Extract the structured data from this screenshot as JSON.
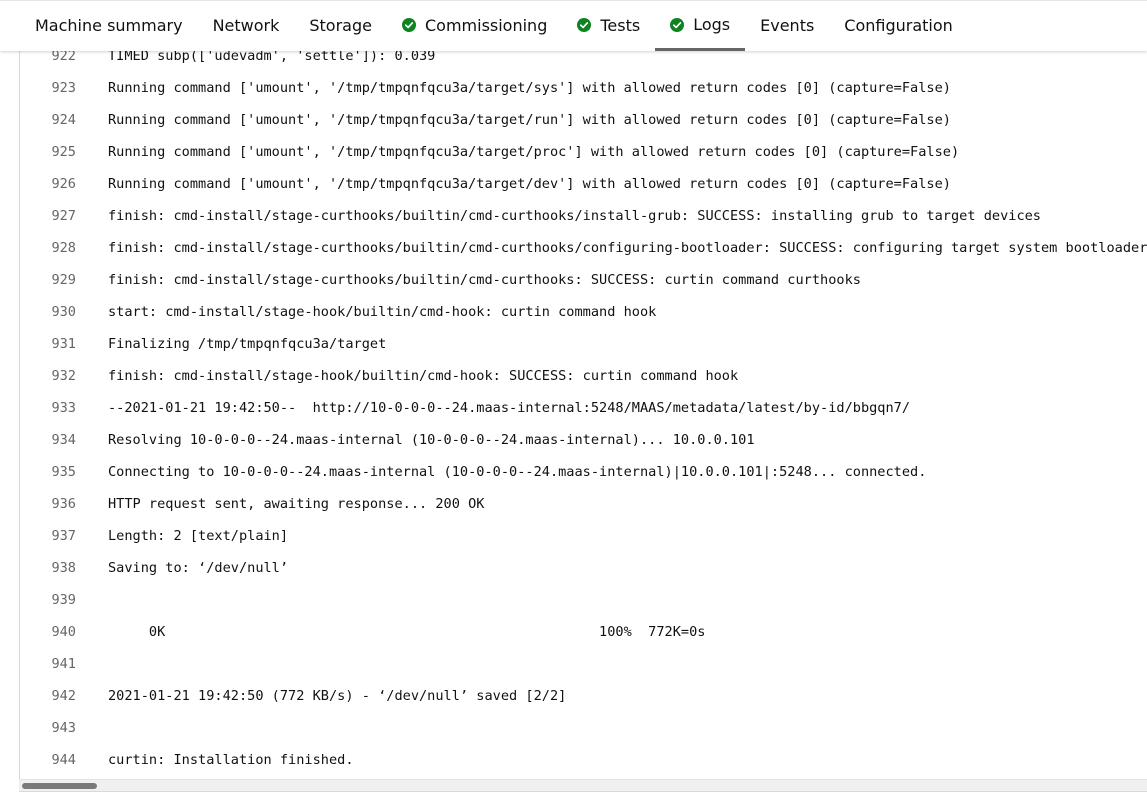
{
  "tabs": [
    {
      "label": "Machine summary",
      "status": null
    },
    {
      "label": "Network",
      "status": null
    },
    {
      "label": "Storage",
      "status": null
    },
    {
      "label": "Commissioning",
      "status": "passed"
    },
    {
      "label": "Tests",
      "status": "passed"
    },
    {
      "label": "Logs",
      "status": "passed",
      "active": true
    },
    {
      "label": "Events",
      "status": null
    },
    {
      "label": "Configuration",
      "status": null
    }
  ],
  "colors": {
    "success": "#0e8420",
    "active_underline": "#666666"
  },
  "log_lines": [
    {
      "num": "922",
      "text": "TIMED subp(['udevadm', 'settle']): 0.039"
    },
    {
      "num": "923",
      "text": "Running command ['umount', '/tmp/tmpqnfqcu3a/target/sys'] with allowed return codes [0] (capture=False)"
    },
    {
      "num": "924",
      "text": "Running command ['umount', '/tmp/tmpqnfqcu3a/target/run'] with allowed return codes [0] (capture=False)"
    },
    {
      "num": "925",
      "text": "Running command ['umount', '/tmp/tmpqnfqcu3a/target/proc'] with allowed return codes [0] (capture=False)"
    },
    {
      "num": "926",
      "text": "Running command ['umount', '/tmp/tmpqnfqcu3a/target/dev'] with allowed return codes [0] (capture=False)"
    },
    {
      "num": "927",
      "text": "finish: cmd-install/stage-curthooks/builtin/cmd-curthooks/install-grub: SUCCESS: installing grub to target devices"
    },
    {
      "num": "928",
      "text": "finish: cmd-install/stage-curthooks/builtin/cmd-curthooks/configuring-bootloader: SUCCESS: configuring target system bootloader"
    },
    {
      "num": "929",
      "text": "finish: cmd-install/stage-curthooks/builtin/cmd-curthooks: SUCCESS: curtin command curthooks"
    },
    {
      "num": "930",
      "text": "start: cmd-install/stage-hook/builtin/cmd-hook: curtin command hook"
    },
    {
      "num": "931",
      "text": "Finalizing /tmp/tmpqnfqcu3a/target"
    },
    {
      "num": "932",
      "text": "finish: cmd-install/stage-hook/builtin/cmd-hook: SUCCESS: curtin command hook"
    },
    {
      "num": "933",
      "text": "--2021-01-21 19:42:50--  http://10-0-0-0--24.maas-internal:5248/MAAS/metadata/latest/by-id/bbgqn7/"
    },
    {
      "num": "934",
      "text": "Resolving 10-0-0-0--24.maas-internal (10-0-0-0--24.maas-internal)... 10.0.0.101"
    },
    {
      "num": "935",
      "text": "Connecting to 10-0-0-0--24.maas-internal (10-0-0-0--24.maas-internal)|10.0.0.101|:5248... connected."
    },
    {
      "num": "936",
      "text": "HTTP request sent, awaiting response... 200 OK"
    },
    {
      "num": "937",
      "text": "Length: 2 [text/plain]"
    },
    {
      "num": "938",
      "text": "Saving to: ‘/dev/null’"
    },
    {
      "num": "939",
      "text": ""
    },
    {
      "num": "940",
      "text": "     0K                                                     100%  772K=0s"
    },
    {
      "num": "941",
      "text": ""
    },
    {
      "num": "942",
      "text": "2021-01-21 19:42:50 (772 KB/s) - ‘/dev/null’ saved [2/2]"
    },
    {
      "num": "943",
      "text": ""
    },
    {
      "num": "944",
      "text": "curtin: Installation finished."
    }
  ]
}
